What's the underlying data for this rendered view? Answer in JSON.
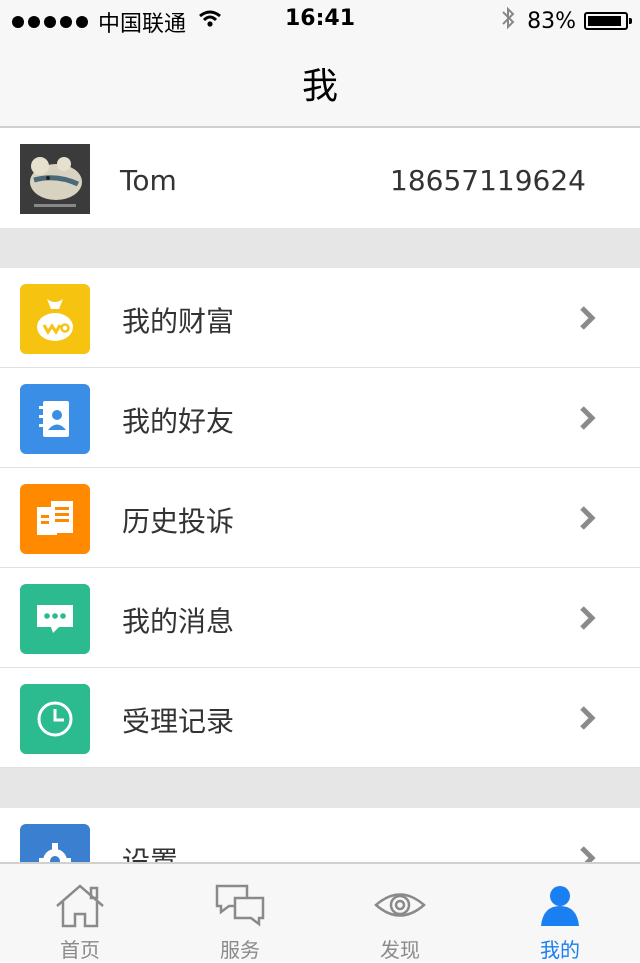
{
  "status_bar": {
    "carrier": "中国联通",
    "time": "16:41",
    "battery": "83%",
    "battery_level": 0.83
  },
  "nav": {
    "title": "我"
  },
  "profile": {
    "name": "Tom",
    "phone": "18657119624"
  },
  "menu": {
    "items": [
      {
        "label": "我的财富",
        "icon": "money-bag-icon",
        "color": "#f5c310"
      },
      {
        "label": "我的好友",
        "icon": "contacts-book-icon",
        "color": "#3a8ee6"
      },
      {
        "label": "历史投诉",
        "icon": "documents-icon",
        "color": "#ff8a00"
      },
      {
        "label": "我的消息",
        "icon": "message-bubble-icon",
        "color": "#2bbb8f"
      },
      {
        "label": "受理记录",
        "icon": "clock-icon",
        "color": "#2bbb8f"
      }
    ],
    "settings": {
      "label": "设置",
      "icon": "gear-icon",
      "color": "#3a7fd0"
    }
  },
  "tabs": [
    {
      "label": "首页",
      "icon": "home-icon",
      "active": false
    },
    {
      "label": "服务",
      "icon": "chat-bubbles-icon",
      "active": false
    },
    {
      "label": "发现",
      "icon": "eye-icon",
      "active": false
    },
    {
      "label": "我的",
      "icon": "user-icon",
      "active": true
    }
  ],
  "colors": {
    "accent": "#1a7ff0",
    "separator": "#e6e6e6"
  }
}
